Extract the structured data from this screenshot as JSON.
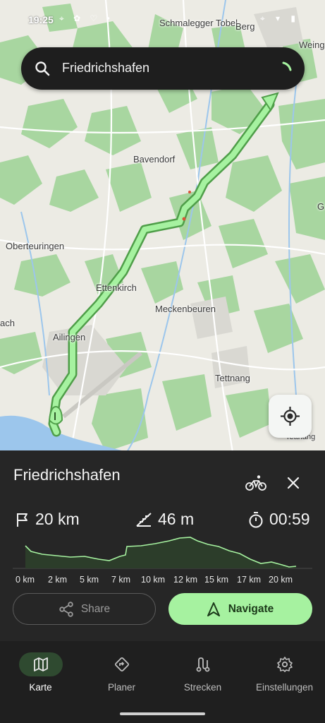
{
  "status": {
    "time": "19:25",
    "left_icons": "⌖ ✿ ♡ •",
    "right_icons": "⌖ ▾ ▮"
  },
  "search": {
    "value": "Friedrichshafen",
    "icon": "search-icon"
  },
  "map": {
    "places": [
      "Schmalegger Tobel",
      "Berg",
      "Weing",
      "Bavendorf",
      "Oberteuringen",
      "Ettenkirch",
      "Meckenbeuren",
      "ach",
      "Ailingen",
      "Tettnang",
      "G",
      "Tettnang"
    ],
    "route_color": "#a6f2a0"
  },
  "route": {
    "title": "Friedrichshafen",
    "mode_icon": "bicycle-icon",
    "distance": "20 km",
    "elevation": "46 m",
    "duration": "00:59"
  },
  "profile": {
    "axis_labels": [
      "0 km",
      "2 km",
      "5 km",
      "7 km",
      "10 km",
      "12 km",
      "15 km",
      "17 km",
      "20 km"
    ]
  },
  "actions": {
    "share": "Share",
    "navigate": "Navigate"
  },
  "bottom_nav": [
    {
      "label": "Karte",
      "icon": "map-icon",
      "active": true
    },
    {
      "label": "Planer",
      "icon": "directions-icon",
      "active": false
    },
    {
      "label": "Strecken",
      "icon": "route-icon",
      "active": false
    },
    {
      "label": "Einstellungen",
      "icon": "gear-icon",
      "active": false
    }
  ],
  "colors": {
    "accent": "#a6f2a0",
    "sheet": "#262626",
    "nav_bg": "#1f1f1f",
    "water": "#9cc6ec",
    "forest": "#a8d6a0"
  }
}
